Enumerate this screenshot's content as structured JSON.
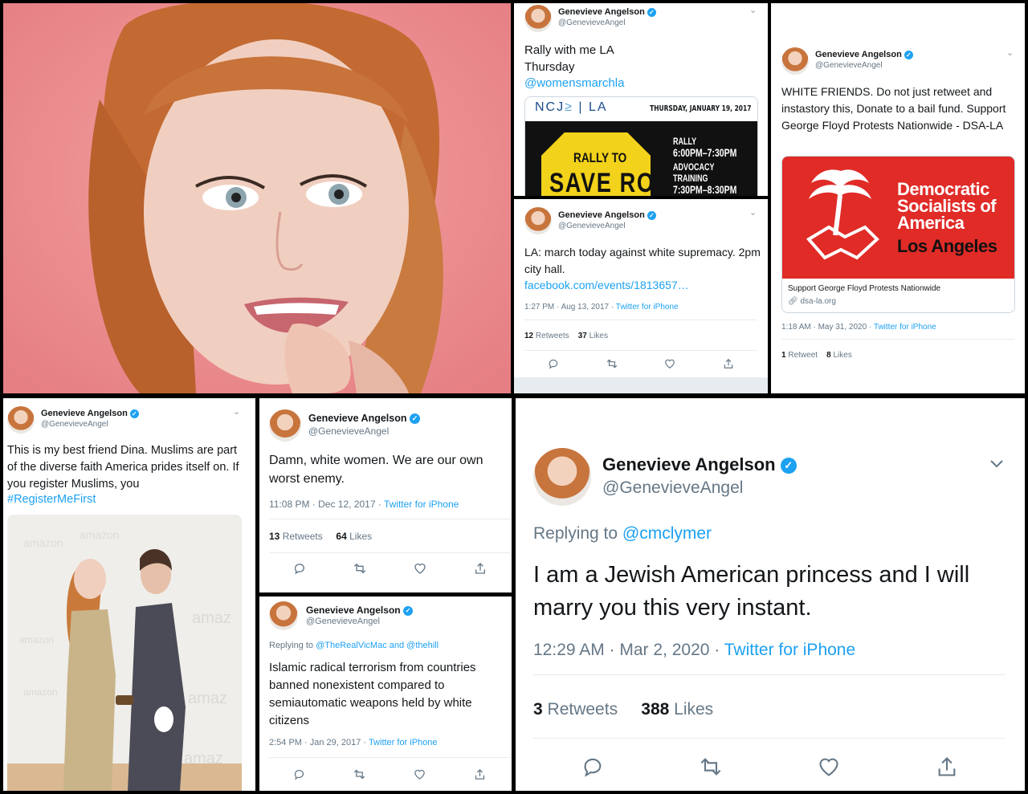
{
  "colors": {
    "twitter_blue": "#1da1f2",
    "muted": "#657786",
    "dsa_red": "#e02b27"
  },
  "icons": [
    "verified-badge-icon",
    "chevron-down-icon",
    "reply-icon",
    "retweet-icon",
    "like-icon",
    "share-icon",
    "link-icon",
    "palm-tree-handshake-logo"
  ],
  "photo_panel": {
    "alt": ""
  },
  "tweet1": {
    "name": "Genevieve Angelson",
    "handle": "@GenevieveAngel",
    "text": "Rally with me LA\nThursday",
    "link": "@womensmarchla",
    "flyer": {
      "logo": "NCJ",
      "logo_suffix": "LA",
      "date": "THURSDAY, JANUARY 19, 2017",
      "sign_line1": "RALLY TO",
      "sign_line2": "SAVE ROE",
      "rally": "RALLY",
      "rally_time": "6:00PM–7:30PM",
      "advocacy": "ADVOCACY TRAINING",
      "advocacy_time": "7:30PM–8:30PM"
    }
  },
  "tweet2": {
    "name": "Genevieve Angelson",
    "handle": "@GenevieveAngel",
    "text": "LA: march today against white supremacy. 2pm city hall.",
    "link": "facebook.com/events/1813657…",
    "time": "1:27 PM · Aug 13, 2017 · ",
    "source": "Twitter for iPhone",
    "retweets": "12",
    "retweets_label": "Retweets",
    "likes": "37",
    "likes_label": "Likes"
  },
  "tweet3": {
    "name": "Genevieve Angelson",
    "handle": "@GenevieveAngel",
    "text": "WHITE FRIENDS. Do not just retweet and instastory this, Donate to a bail fund. Support George Floyd Protests Nationwide - DSA-LA",
    "card_line1": "Democratic",
    "card_line2": "Socialists of",
    "card_line3": "America",
    "card_line4": "Los Angeles",
    "card_title": "Support George Floyd Protests Nationwide",
    "card_domain": "dsa-la.org",
    "time": "1:18 AM · May 31, 2020 · ",
    "source": "Twitter for iPhone",
    "retweets": "1",
    "retweets_label": "Retweet",
    "likes": "8",
    "likes_label": "Likes"
  },
  "tweet4": {
    "name": "Genevieve Angelson",
    "handle": "@GenevieveAngel",
    "text": "This is my best friend Dina. Muslims are part of the diverse faith America prides itself on. If you register Muslims, you",
    "hashtag": "#RegisterMeFirst",
    "backdrop_word": "amazon"
  },
  "tweet5": {
    "name": "Genevieve Angelson",
    "handle": "@GenevieveAngel",
    "text": "Damn, white women. We are our own worst enemy.",
    "time": "11:08 PM · Dec 12, 2017 · ",
    "source": "Twitter for iPhone",
    "retweets": "13",
    "retweets_label": "Retweets",
    "likes": "64",
    "likes_label": "Likes"
  },
  "tweet6": {
    "name": "Genevieve Angelson",
    "handle": "@GenevieveAngel",
    "replying_prefix": "Replying to ",
    "replying_to": "@TheRealVicMac and @thehill",
    "text": "Islamic radical terrorism from countries banned nonexistent compared to semiautomatic weapons held by white citizens",
    "time": "2:54 PM · Jan 29, 2017 · ",
    "source": "Twitter for iPhone"
  },
  "tweet7": {
    "name": "Genevieve Angelson",
    "handle": "@GenevieveAngel",
    "replying_prefix": "Replying to ",
    "replying_to": "@cmclymer",
    "text": "I am a Jewish American princess and I will marry you this very instant.",
    "time": "12:29 AM · Mar 2, 2020 · ",
    "source": "Twitter for iPhone",
    "retweets": "3",
    "retweets_label": "Retweets",
    "likes": "388",
    "likes_label": "Likes"
  }
}
